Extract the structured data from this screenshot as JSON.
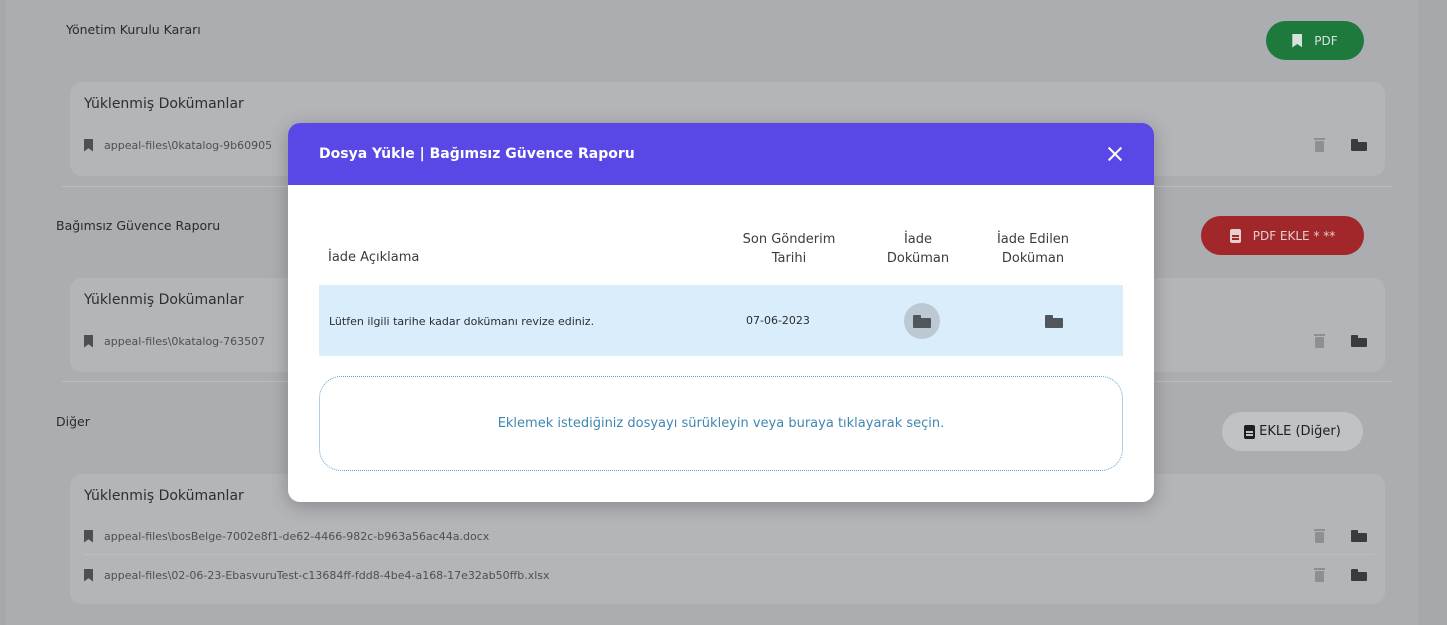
{
  "background": {
    "sections": [
      {
        "title": "Yönetim Kurulu Kararı",
        "button": "PDF",
        "card_title": "Yüklenmiş Dokümanlar",
        "files": [
          "appeal-files\\0katalog-9b60905"
        ]
      },
      {
        "title": "Bağımsız Güvence Raporu",
        "button": "PDF EKLE * **",
        "card_title": "Yüklenmiş Dokümanlar",
        "files": [
          "appeal-files\\0katalog-763507"
        ]
      },
      {
        "title": "Diğer",
        "button": "EKLE (Diğer)",
        "card_title": "Yüklenmiş Dokümanlar",
        "files": [
          "appeal-files\\bosBelge-7002e8f1-de62-4466-982c-b963a56ac44a.docx",
          "appeal-files\\02-06-23-EbasvuruTest-c13684ff-fdd8-4be4-a168-17e32ab50ffb.xlsx"
        ]
      }
    ]
  },
  "modal": {
    "title": "Dosya Yükle | Bağımsız Güvence Raporu",
    "columns": {
      "aciklama": "İade Açıklama",
      "son_gonderim_line1": "Son Gönderim",
      "son_gonderim_line2": "Tarihi",
      "iade_doc_line1": "İade",
      "iade_doc_line2": "Doküman",
      "iade_edilen_line1": "İade Edilen",
      "iade_edilen_line2": "Doküman"
    },
    "row": {
      "aciklama": "Lütfen ilgili tarihe kadar dokümanı revize ediniz.",
      "tarih": "07-06-2023"
    },
    "dropzone_text": "Eklemek istediğiniz dosyayı sürükleyin veya  buraya tıklayarak seçin."
  },
  "colors": {
    "modal_header": "#5947e6",
    "pdf_button": "#1e7a3c",
    "pdf_ekle_button": "#a1272a",
    "row_highlight": "#d9eefa",
    "dropzone_text": "#3e87b1"
  },
  "icons": [
    "bookmark-icon",
    "trash-icon",
    "folder-icon",
    "close-icon",
    "document-icon"
  ]
}
